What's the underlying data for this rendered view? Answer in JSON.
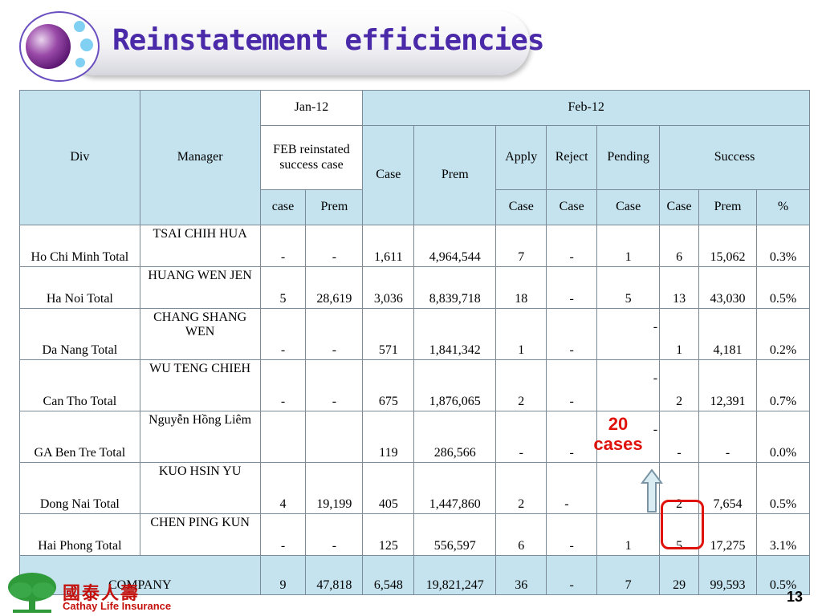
{
  "slide": {
    "title": "Reinstatement efficiencies",
    "page_number": "13",
    "annotation": {
      "line1": "20",
      "line2": "cases"
    },
    "accent_red": "#e0120c"
  },
  "brand": {
    "name_cn": "國泰人壽",
    "name_en": "Cathay Life Insurance"
  },
  "table": {
    "headers": {
      "div": "Div",
      "manager": "Manager",
      "jan": "Jan-12",
      "feb": "Feb-12",
      "feb_reinstated": "FEB reinstated success case",
      "case": "Case",
      "prem": "Prem",
      "apply": "Apply",
      "reject": "Reject",
      "pending": "Pending",
      "success": "Success",
      "sub_case_lower": "case",
      "sub_prem": "Prem",
      "sub_apply_case": "Case",
      "sub_reject_case": "Case",
      "sub_pending_case": "Case",
      "sub_success_case": "Case",
      "sub_success_prem": "Prem",
      "sub_success_pct": "%"
    },
    "rows": [
      {
        "div": "Ho Chi Minh Total",
        "manager": "TSAI CHIH HUA",
        "jan_case": "-",
        "jan_prem": "-",
        "case": "1,611",
        "prem": "4,964,544",
        "apply": "7",
        "reject": "-",
        "pending": "1",
        "s_case": "6",
        "s_prem": "15,062",
        "s_pct": "0.3%"
      },
      {
        "div": "Ha Noi Total",
        "manager": "HUANG WEN JEN",
        "jan_case": "5",
        "jan_prem": "28,619",
        "case": "3,036",
        "prem": "8,839,718",
        "apply": "18",
        "reject": "-",
        "pending": "5",
        "s_case": "13",
        "s_prem": "43,030",
        "s_pct": "0.5%"
      },
      {
        "div": "Da Nang Total",
        "manager": "CHANG SHANG WEN",
        "jan_case": "-",
        "jan_prem": "-",
        "case": "571",
        "prem": "1,841,342",
        "apply": "1",
        "reject": "-",
        "pending": "-",
        "s_case": "1",
        "s_prem": "4,181",
        "s_pct": "0.2%"
      },
      {
        "div": "Can Tho Total",
        "manager": "WU TENG CHIEH",
        "jan_case": "-",
        "jan_prem": "-",
        "case": "675",
        "prem": "1,876,065",
        "apply": "2",
        "reject": "-",
        "pending": "-",
        "s_case": "2",
        "s_prem": "12,391",
        "s_pct": "0.7%"
      },
      {
        "div": "GA Ben Tre Total",
        "manager": "Nguyễn Hồng Liêm",
        "jan_case": "",
        "jan_prem": "",
        "case": "119",
        "prem": "286,566",
        "apply": "-",
        "reject": "-",
        "pending": "-",
        "s_case": "-",
        "s_prem": "-",
        "s_pct": "0.0%"
      },
      {
        "div": "Dong Nai Total",
        "manager": "KUO HSIN YU",
        "jan_case": "4",
        "jan_prem": "19,199",
        "case": "405",
        "prem": "1,447,860",
        "apply": "2",
        "reject": "-",
        "pending": "-",
        "s_case": "2",
        "s_prem": "7,654",
        "s_pct": "0.5%"
      },
      {
        "div": "Hai Phong Total",
        "manager": "CHEN PING KUN",
        "jan_case": "-",
        "jan_prem": "-",
        "case": "125",
        "prem": "556,597",
        "apply": "6",
        "reject": "-",
        "pending": "1",
        "s_case": "5",
        "s_prem": "17,275",
        "s_pct": "3.1%"
      }
    ],
    "company": {
      "label": "COMPANY",
      "jan_case": "9",
      "jan_prem": "47,818",
      "case": "6,548",
      "prem": "19,821,247",
      "apply": "36",
      "reject": "-",
      "pending": "7",
      "s_case": "29",
      "s_prem": "99,593",
      "s_pct": "0.5%"
    }
  }
}
